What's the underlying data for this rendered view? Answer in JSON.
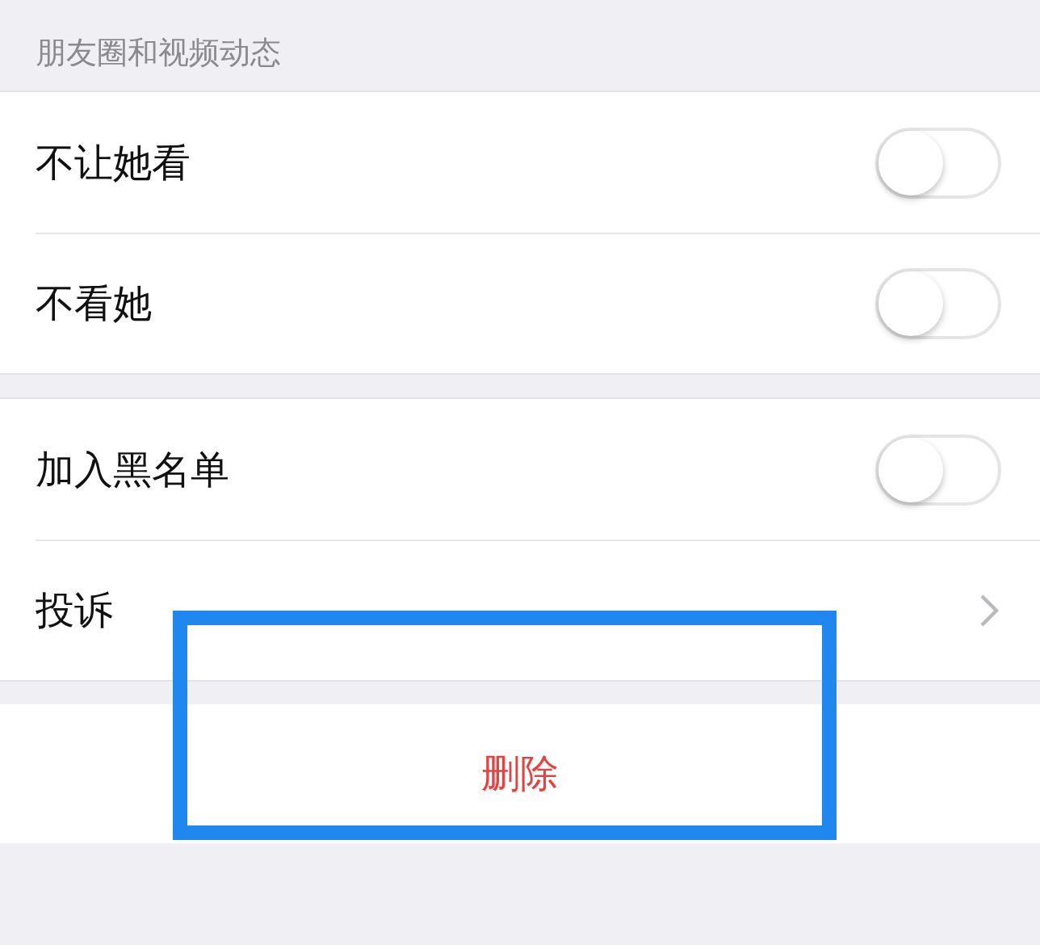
{
  "section_header": "朋友圈和视频动态",
  "groups": [
    {
      "rows": [
        {
          "kind": "toggle",
          "label": "不让她看",
          "on": false
        },
        {
          "kind": "toggle",
          "label": "不看她",
          "on": false
        }
      ]
    },
    {
      "rows": [
        {
          "kind": "toggle",
          "label": "加入黑名单",
          "on": false
        },
        {
          "kind": "link",
          "label": "投诉"
        }
      ]
    }
  ],
  "delete_button": {
    "label": "删除"
  }
}
